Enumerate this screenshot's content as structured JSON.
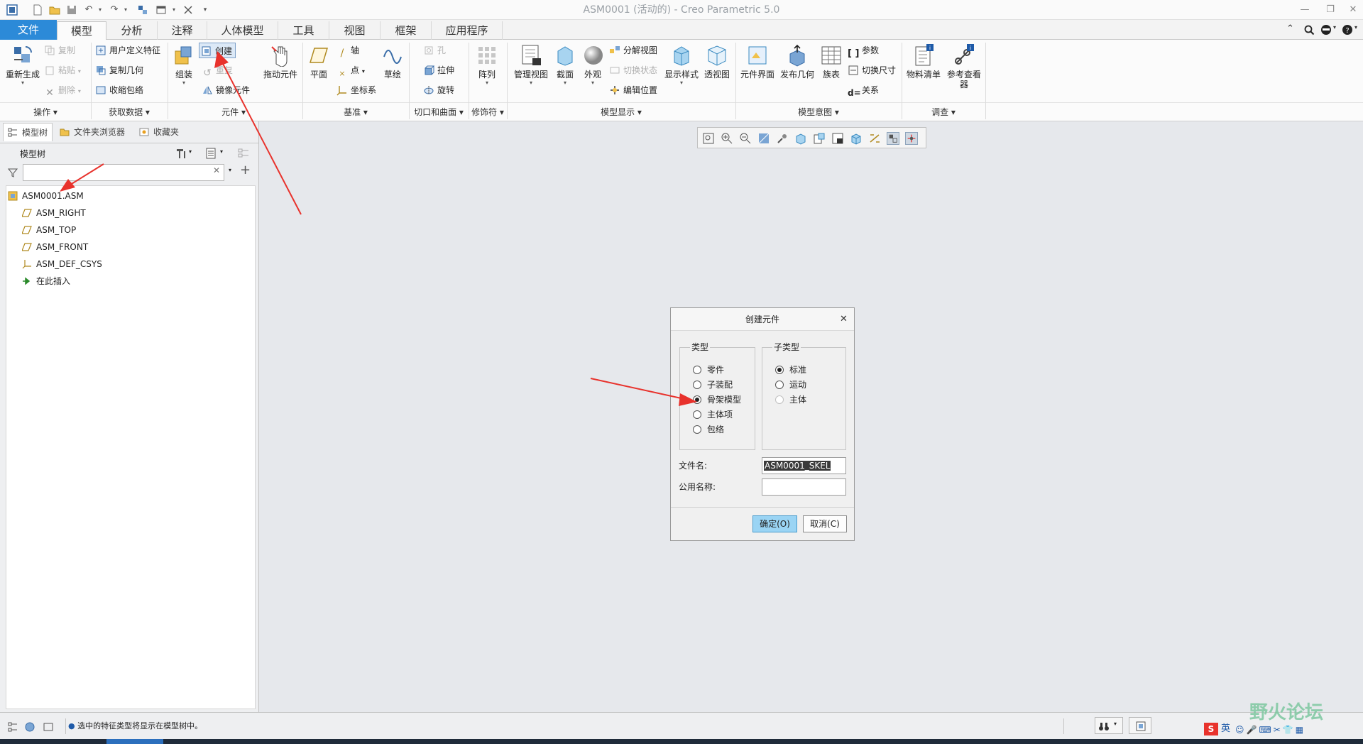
{
  "app": {
    "title": "ASM0001 (活动的) - Creo Parametric 5.0"
  },
  "tabs": [
    {
      "label": "文件"
    },
    {
      "label": "模型"
    },
    {
      "label": "分析"
    },
    {
      "label": "注释"
    },
    {
      "label": "人体模型"
    },
    {
      "label": "工具"
    },
    {
      "label": "视图"
    },
    {
      "label": "框架"
    },
    {
      "label": "应用程序"
    }
  ],
  "ribbon": {
    "groups": {
      "ops": "操作",
      "getdata": "获取数据",
      "component": "元件",
      "datum": "基准",
      "cut": "切口和曲面",
      "modifier": "修饰符",
      "display": "模型显示",
      "intent": "模型意图",
      "investigate": "调查"
    },
    "regenerate": "重新生成",
    "copy": "复制",
    "paste": "粘贴",
    "delete": "删除",
    "udf": "用户定义特征",
    "copy_geom": "复制几何",
    "shrinkwrap": "收缩包络",
    "assemble": "组装",
    "create": "创建",
    "repeat": "重复",
    "mirror": "镜像元件",
    "drag": "拖动元件",
    "plane": "平面",
    "axis": "轴",
    "point": "点",
    "csys": "坐标系",
    "sketch": "草绘",
    "hole": "孔",
    "extrude": "拉伸",
    "revolve": "旋转",
    "pattern": "阵列",
    "manage_views": "管理视图",
    "section": "截面",
    "appearance": "外观",
    "explode": "分解视图",
    "toggle_state": "切换状态",
    "edit_pos": "编辑位置",
    "display_style": "显示样式",
    "perspective": "透视图",
    "comp_interface": "元件界面",
    "publish_geom": "发布几何",
    "family_table": "族表",
    "params": "参数",
    "switch_dims": "切换尺寸",
    "relations": "关系",
    "bom": "物料清单",
    "ref_viewer_1": "参考查看",
    "ref_viewer_2": "器"
  },
  "panel": {
    "tabs": [
      {
        "label": "模型树"
      },
      {
        "label": "文件夹浏览器"
      },
      {
        "label": "收藏夹"
      }
    ],
    "tree_title": "模型树",
    "tree": [
      {
        "label": "ASM0001.ASM"
      },
      {
        "label": "ASM_RIGHT"
      },
      {
        "label": "ASM_TOP"
      },
      {
        "label": "ASM_FRONT"
      },
      {
        "label": "ASM_DEF_CSYS"
      },
      {
        "label": "在此插入"
      }
    ]
  },
  "dialog": {
    "title": "创建元件",
    "type_legend": "类型",
    "types": [
      {
        "label": "零件",
        "selected": false
      },
      {
        "label": "子装配",
        "selected": false
      },
      {
        "label": "骨架模型",
        "selected": true
      },
      {
        "label": "主体项",
        "selected": false
      },
      {
        "label": "包络",
        "selected": false
      }
    ],
    "subtype_legend": "子类型",
    "subtypes": [
      {
        "label": "标准",
        "selected": true
      },
      {
        "label": "运动",
        "selected": false
      },
      {
        "label": "主体",
        "selected": false,
        "disabled": true
      }
    ],
    "filename_label": "文件名:",
    "filename_value": "ASM0001_SKEL",
    "common_name_label": "公用名称:",
    "ok": "确定(O)",
    "cancel": "取消(C)"
  },
  "status": {
    "message": "选中的特征类型将显示在模型树中。"
  },
  "watermark": {
    "text": "野火论坛",
    "ime": "英"
  },
  "colors": {
    "accent": "#2c8ad8",
    "annotation_arrow": "#e8322c"
  }
}
